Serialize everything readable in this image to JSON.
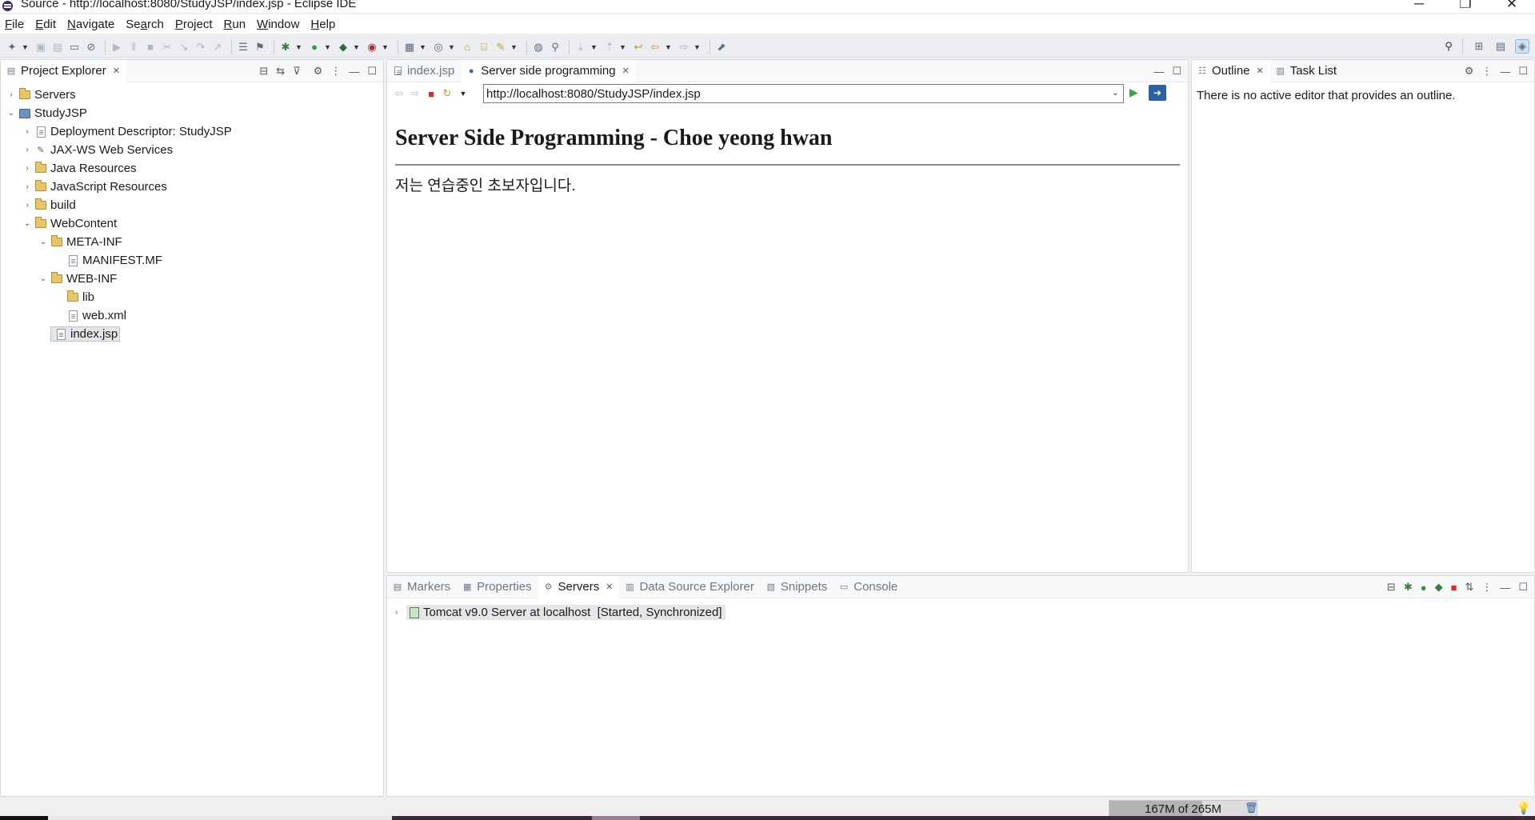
{
  "window": {
    "title": "Source - http://localhost:8080/StudyJSP/index.jsp - Eclipse IDE",
    "controls": {
      "minimize": "─",
      "restore": "❐",
      "close": "✕"
    }
  },
  "menu": {
    "items": [
      {
        "label": "File",
        "mnemonic": "F",
        "rest": "ile"
      },
      {
        "label": "Edit",
        "mnemonic": "E",
        "rest": "dit"
      },
      {
        "label": "Navigate",
        "mnemonic": "N",
        "rest": "avigate"
      },
      {
        "label": "Search",
        "mnemonic": "a",
        "pre": "Se",
        "rest": "rch"
      },
      {
        "label": "Project",
        "mnemonic": "P",
        "rest": "roject"
      },
      {
        "label": "Run",
        "mnemonic": "R",
        "rest": "un"
      },
      {
        "label": "Window",
        "mnemonic": "W",
        "rest": "indow"
      },
      {
        "label": "Help",
        "mnemonic": "H",
        "rest": "elp"
      }
    ]
  },
  "project_explorer": {
    "tab_label": "Project Explorer",
    "tree": [
      {
        "label": "Servers",
        "level": 0,
        "expanded": false,
        "icon": "folder-icon"
      },
      {
        "label": "StudyJSP",
        "level": 0,
        "expanded": true,
        "icon": "project-icon"
      },
      {
        "label": "Deployment Descriptor: StudyJSP",
        "level": 1,
        "expanded": false,
        "icon": "descriptor-icon"
      },
      {
        "label": "JAX-WS Web Services",
        "level": 1,
        "expanded": false,
        "icon": "webservice-icon"
      },
      {
        "label": "Java Resources",
        "level": 1,
        "expanded": false,
        "icon": "java-resources-icon"
      },
      {
        "label": "JavaScript Resources",
        "level": 1,
        "expanded": false,
        "icon": "javascript-resources-icon"
      },
      {
        "label": "build",
        "level": 1,
        "expanded": false,
        "icon": "folder-icon"
      },
      {
        "label": "WebContent",
        "level": 1,
        "expanded": true,
        "icon": "folder-icon"
      },
      {
        "label": "META-INF",
        "level": 2,
        "expanded": true,
        "icon": "folder-icon"
      },
      {
        "label": "MANIFEST.MF",
        "level": 3,
        "icon": "file-icon"
      },
      {
        "label": "WEB-INF",
        "level": 2,
        "expanded": true,
        "icon": "folder-icon"
      },
      {
        "label": "lib",
        "level": 3,
        "icon": "folder-icon"
      },
      {
        "label": "web.xml",
        "level": 3,
        "icon": "xml-file-icon"
      },
      {
        "label": "index.jsp",
        "level": 2,
        "icon": "file-icon",
        "selected": true
      }
    ]
  },
  "editor": {
    "tabs": [
      {
        "label": "index.jsp",
        "active": false
      },
      {
        "label": "Server side programming",
        "active": true
      }
    ],
    "url": "http://localhost:8080/StudyJSP/index.jsp",
    "page": {
      "heading": "Server Side Programming - Choe yeong hwan",
      "paragraph": "저는 연습중인 초보자입니다."
    }
  },
  "outline": {
    "tabs": [
      {
        "label": "Outline",
        "active": true
      },
      {
        "label": "Task List",
        "active": false
      }
    ],
    "message": "There is no active editor that provides an outline."
  },
  "bottom_panel": {
    "tabs": [
      {
        "label": "Markers",
        "active": false
      },
      {
        "label": "Properties",
        "active": false
      },
      {
        "label": "Servers",
        "active": true
      },
      {
        "label": "Data Source Explorer",
        "active": false
      },
      {
        "label": "Snippets",
        "active": false
      },
      {
        "label": "Console",
        "active": false
      }
    ],
    "server_entry": "Tomcat v9.0 Server at localhost  [Started, Synchronized]"
  },
  "status": {
    "heap": "167M of 265M",
    "heap_used_fraction": 0.63
  }
}
